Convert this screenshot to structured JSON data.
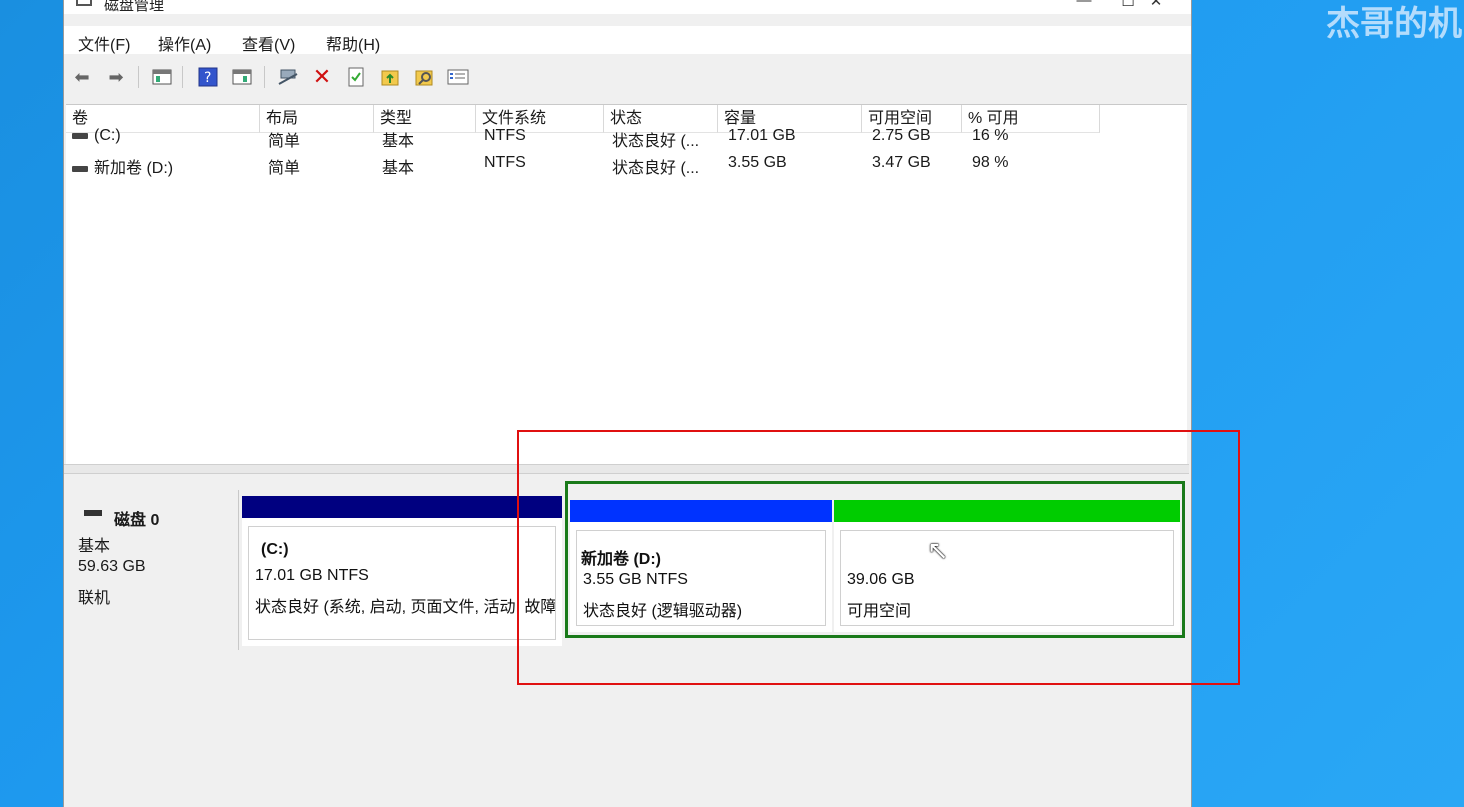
{
  "window": {
    "title": "磁盘管理"
  },
  "watermark": "杰哥的机",
  "menu": [
    "文件(F)",
    "操作(A)",
    "查看(V)",
    "帮助(H)"
  ],
  "toolbar": {
    "icons": [
      "back-arrow-icon",
      "forward-arrow-icon",
      "console-tree-icon",
      "help-icon",
      "show-hide-icon",
      "connect-icon",
      "delete-icon",
      "properties-icon",
      "up-folder-icon",
      "search-folder-icon",
      "list-view-icon"
    ]
  },
  "list": {
    "columns": [
      "卷",
      "布局",
      "类型",
      "文件系统",
      "状态",
      "容量",
      "可用空间",
      "% 可用"
    ],
    "rows": [
      [
        "(C:)",
        "简单",
        "基本",
        "NTFS",
        "状态良好 (...",
        "17.01 GB",
        "2.75 GB",
        "16 %"
      ],
      [
        "新加卷 (D:)",
        "简单",
        "基本",
        "NTFS",
        "状态良好 (...",
        "3.55 GB",
        "3.47 GB",
        "98 %"
      ]
    ]
  },
  "disk": {
    "name": "磁盘 0",
    "type": "基本",
    "size": "59.63 GB",
    "state": "联机",
    "partitions": [
      {
        "name": "(C:)",
        "size": "17.01 GB NTFS",
        "status": "状态良好 (系统, 启动, 页面文件, 活动, 故障转储, 主分区)",
        "color": "#000080"
      },
      {
        "name": "新加卷  (D:)",
        "size": "3.55 GB NTFS",
        "status": "状态良好 (逻辑驱动器)",
        "color": "#0033ff"
      },
      {
        "name": "",
        "size": "39.06 GB",
        "status": "可用空间",
        "color": "#00cc00"
      }
    ]
  }
}
